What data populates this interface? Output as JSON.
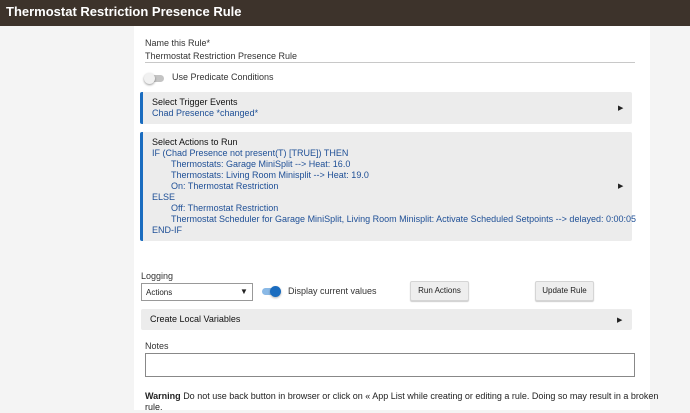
{
  "header": {
    "title": "Thermostat Restriction Presence Rule"
  },
  "rule_name": {
    "label": "Name this Rule*",
    "value": "Thermostat Restriction Presence Rule"
  },
  "predicate": {
    "label": "Use Predicate Conditions",
    "enabled": false
  },
  "trigger": {
    "heading": "Select Trigger Events",
    "value": "Chad Presence *changed*"
  },
  "actions": {
    "heading": "Select Actions to Run",
    "lines": [
      "IF (Chad Presence not present(T) [TRUE]) THEN",
      "Thermostats: Garage MiniSplit --> Heat: 16.0",
      "Thermostats: Living Room Minisplit --> Heat: 19.0",
      "On: Thermostat Restriction",
      "ELSE",
      "Off: Thermostat Restriction",
      "Thermostat Scheduler for Garage MiniSplit, Living Room Minisplit: Activate Scheduled Setpoints --> delayed: 0:00:05",
      "END-IF"
    ]
  },
  "logging": {
    "label": "Logging",
    "selected": "Actions"
  },
  "display_values": {
    "label": "Display current values",
    "enabled": true
  },
  "buttons": {
    "run_actions": "Run Actions",
    "update_rule": "Update Rule"
  },
  "local_vars": {
    "label": "Create Local Variables"
  },
  "notes": {
    "label": "Notes",
    "value": ""
  },
  "warning": {
    "bold": "Warning",
    "text": "Do not use back button in browser or click on « App List while creating or editing a rule. Doing so may result in a broken",
    "text2": "rule."
  },
  "colors": {
    "accent": "#1a6cbf",
    "header_bg": "#3d332b",
    "action_text": "#1e4f96"
  },
  "icons": {
    "expand": "triangle-right-icon",
    "dropdown": "caret-down-icon"
  }
}
